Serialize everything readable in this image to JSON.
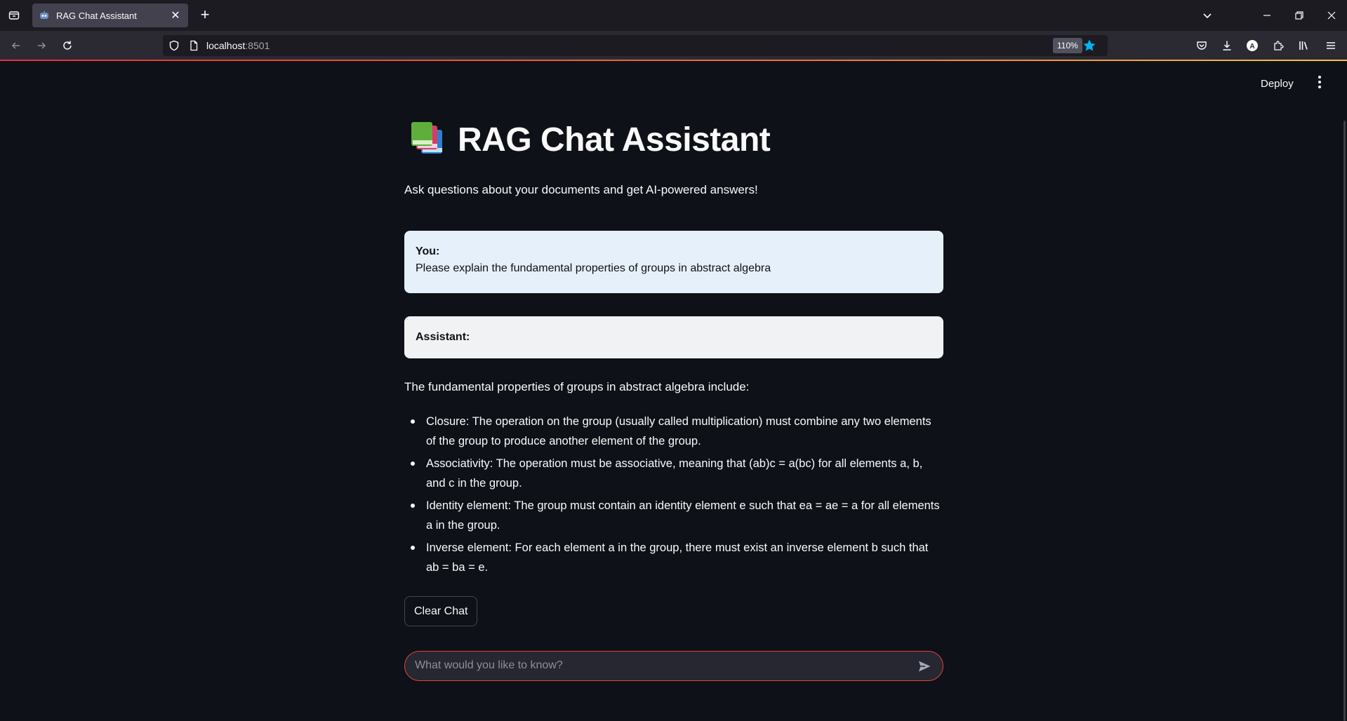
{
  "browser": {
    "tab_title": "RAG Chat Assistant",
    "url_host": "localhost",
    "url_port": ":8501",
    "zoom": "110%",
    "accent_color": "#00b3f4"
  },
  "header": {
    "deploy_label": "Deploy"
  },
  "page": {
    "title_icon": "📚",
    "title": "RAG Chat Assistant",
    "subtitle": "Ask questions about your documents and get AI-powered answers!"
  },
  "messages": {
    "user_label": "You:",
    "user_text": "Please explain the fundamental properties of groups in abstract algebra",
    "assistant_label": "Assistant:"
  },
  "answer": {
    "intro": "The fundamental properties of groups in abstract algebra include:",
    "items": [
      "Closure: The operation on the group (usually called multiplication) must combine any two elements of the group to produce another element of the group.",
      "Associativity: The operation must be associative, meaning that (ab)c = a(bc) for all elements a, b, and c in the group.",
      "Identity element: The group must contain an identity element e such that ea = ae = a for all elements a in the group.",
      "Inverse element: For each element a in the group, there must exist an inverse element b such that ab = ba = e."
    ]
  },
  "controls": {
    "clear_label": "Clear Chat",
    "input_placeholder": "What would you like to know?",
    "input_border_color": "#e2443a"
  }
}
